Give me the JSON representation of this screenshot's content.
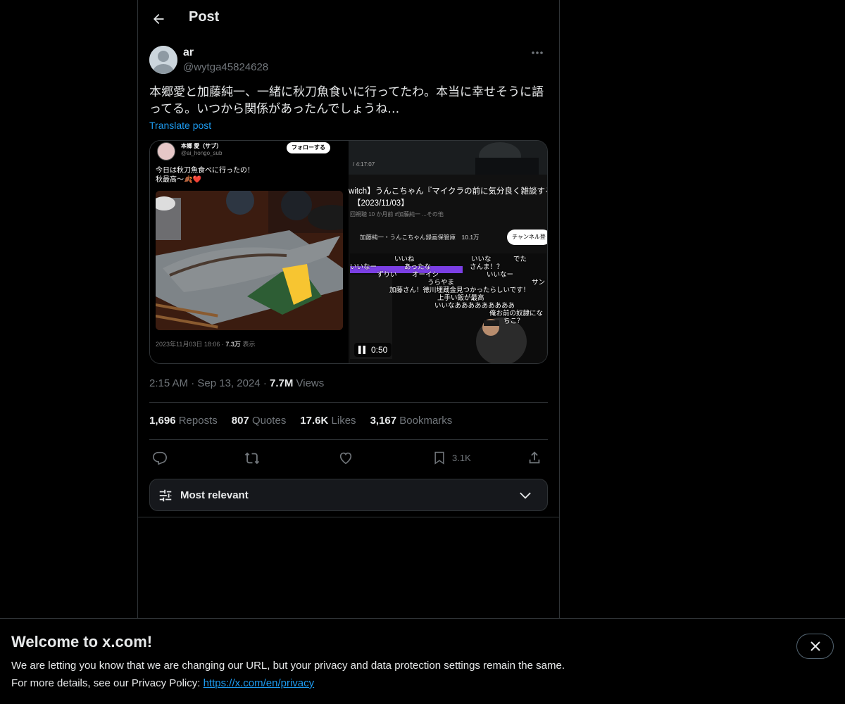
{
  "header": {
    "title": "Post",
    "back_icon": "arrow-left-icon"
  },
  "post": {
    "author": {
      "display_name": "ar",
      "handle": "@wytga45824628"
    },
    "text": "本郷愛と加藤純一、一緒に秋刀魚食いに行ってたわ。本当に幸せそうに語ってる。いつから関係があったんでしょうね…",
    "translate_label": "Translate post",
    "media": {
      "left": {
        "name": "本郷 愛（サブ）",
        "handle": "@ai_hongo_sub",
        "follow": "フォローする",
        "line1": "今日は秋刀魚食べに行ったの！",
        "line2": "秋最高〜🍂❤️",
        "meta_date": "2023年11月03日 18:06 ·",
        "meta_views": "7.3万",
        "meta_views_suffix": "表示"
      },
      "right": {
        "title1": "witch】うんこちゃん『マイクラの前に気分良く雑談する",
        "title2": "【2023/11/03】",
        "sub": "回視聴 10 か月前 #加藤純一 ...その他",
        "channel": "加藤純一・うんこちゃん録画保管庫　10.1万",
        "subscribe": "チャンネル登",
        "top_time": "/ 4:17:07",
        "comments": [
          "いいね",
          "あったな",
          "いいな",
          "でた",
          "いいなー",
          "ずりい",
          "さんま！？",
          "オーイシ",
          "いいなー",
          "うらやま",
          "サン",
          "加藤さん！徳川埋蔵金見つかったらしいです！",
          "上手い飯が最高",
          "いいなあああああああああ",
          "俺お前の奴隷にな",
          "ちこ？"
        ]
      },
      "video_time": "0:50"
    },
    "time": "2:15 AM",
    "date": "Sep 13, 2024",
    "views_count": "7.7M",
    "views_label": "Views",
    "sep": "·",
    "stats": {
      "reposts_count": "1,696",
      "reposts_label": "Reposts",
      "quotes_count": "807",
      "quotes_label": "Quotes",
      "likes_count": "17.6K",
      "likes_label": "Likes",
      "bookmarks_count": "3,167",
      "bookmarks_label": "Bookmarks"
    },
    "actions": {
      "bookmark_count": "3.1K"
    }
  },
  "sort": {
    "label": "Most relevant"
  },
  "banner": {
    "title": "Welcome to x.com!",
    "line1": "We are letting you know that we are changing our URL, but your privacy and data protection settings remain the same.",
    "line2_prefix": "For more details, see our Privacy Policy: ",
    "link": "https://x.com/en/privacy"
  },
  "colors": {
    "accent": "#1d9bf0",
    "text": "#e7e9ea",
    "muted": "#71767b",
    "border": "#2f3336",
    "bg": "#000000"
  }
}
